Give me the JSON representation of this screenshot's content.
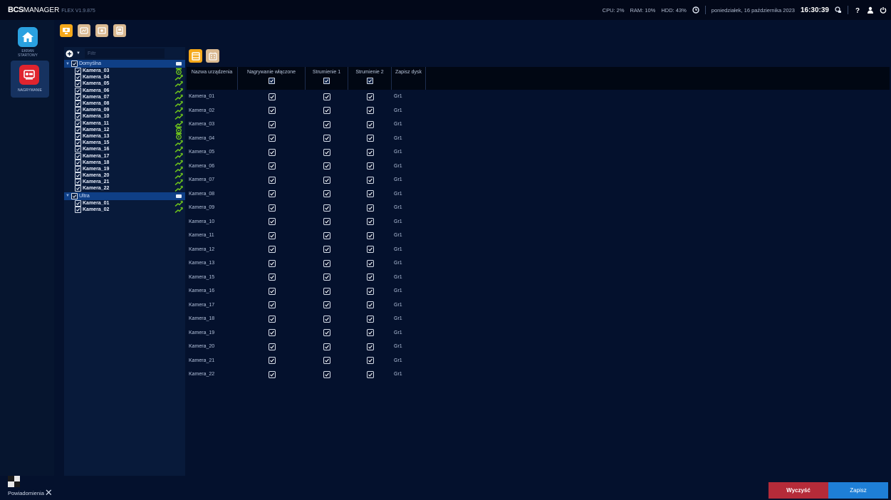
{
  "app": {
    "brand_bcs": "BCS",
    "brand_manager": "MANAGER",
    "version": "FLEX V1.9.875"
  },
  "status": {
    "cpu": "CPU:  2%",
    "ram": "RAM:  10%",
    "hdd": "HDD:  43%",
    "date": "poniedziałek, 16 października 2023",
    "time": "16:30:39"
  },
  "nav": {
    "home_label_1": "EKRAN",
    "home_label_2": "STARTOWY",
    "rec_label": "NAGRYWANIE"
  },
  "tree": {
    "filter_placeholder": "Filtr",
    "groups": [
      {
        "name": "Domyślna",
        "cameras": [
          {
            "name": "Kamera_03",
            "status": "record"
          },
          {
            "name": "Kamera_04",
            "status": "signal"
          },
          {
            "name": "Kamera_05",
            "status": "signal"
          },
          {
            "name": "Kamera_06",
            "status": "signal"
          },
          {
            "name": "Kamera_07",
            "status": "signal"
          },
          {
            "name": "Kamera_08",
            "status": "signal"
          },
          {
            "name": "Kamera_09",
            "status": "signal"
          },
          {
            "name": "Kamera_10",
            "status": "signal"
          },
          {
            "name": "Kamera_11",
            "status": "signal"
          },
          {
            "name": "Kamera_12",
            "status": "record"
          },
          {
            "name": "Kamera_13",
            "status": "record"
          },
          {
            "name": "Kamera_15",
            "status": "signal"
          },
          {
            "name": "Kamera_16",
            "status": "signal"
          },
          {
            "name": "Kamera_17",
            "status": "signal"
          },
          {
            "name": "Kamera_18",
            "status": "signal"
          },
          {
            "name": "Kamera_19",
            "status": "signal"
          },
          {
            "name": "Kamera_20",
            "status": "signal"
          },
          {
            "name": "Kamera_21",
            "status": "signal"
          },
          {
            "name": "Kamera_22",
            "status": "signal"
          }
        ]
      },
      {
        "name": "Ultra",
        "cameras": [
          {
            "name": "Kamera_01",
            "status": "signal"
          },
          {
            "name": "Kamera_02",
            "status": "signal"
          }
        ]
      }
    ]
  },
  "table": {
    "headers": {
      "name": "Nazwa urządzenia",
      "recording": "Nagrywanie włączone",
      "stream1": "Strumienie 1",
      "stream2": "Strumienie 2",
      "disk": "Zapisz dysk"
    },
    "rows": [
      {
        "name": "Kamera_01",
        "recording": true,
        "stream1": true,
        "stream2": true,
        "disk": "Gr1"
      },
      {
        "name": "Kamera_02",
        "recording": true,
        "stream1": true,
        "stream2": true,
        "disk": "Gr1"
      },
      {
        "name": "Kamera_03",
        "recording": true,
        "stream1": true,
        "stream2": true,
        "disk": "Gr1"
      },
      {
        "name": "Kamera_04",
        "recording": true,
        "stream1": true,
        "stream2": true,
        "disk": "Gr1"
      },
      {
        "name": "Kamera_05",
        "recording": true,
        "stream1": true,
        "stream2": true,
        "disk": "Gr1"
      },
      {
        "name": "Kamera_06",
        "recording": true,
        "stream1": true,
        "stream2": true,
        "disk": "Gr1"
      },
      {
        "name": "Kamera_07",
        "recording": true,
        "stream1": true,
        "stream2": true,
        "disk": "Gr1"
      },
      {
        "name": "Kamera_08",
        "recording": true,
        "stream1": true,
        "stream2": true,
        "disk": "Gr1"
      },
      {
        "name": "Kamera_09",
        "recording": true,
        "stream1": true,
        "stream2": true,
        "disk": "Gr1"
      },
      {
        "name": "Kamera_10",
        "recording": true,
        "stream1": true,
        "stream2": true,
        "disk": "Gr1"
      },
      {
        "name": "Kamera_11",
        "recording": true,
        "stream1": true,
        "stream2": true,
        "disk": "Gr1"
      },
      {
        "name": "Kamera_12",
        "recording": true,
        "stream1": true,
        "stream2": true,
        "disk": "Gr1"
      },
      {
        "name": "Kamera_13",
        "recording": true,
        "stream1": true,
        "stream2": true,
        "disk": "Gr1"
      },
      {
        "name": "Kamera_15",
        "recording": true,
        "stream1": true,
        "stream2": true,
        "disk": "Gr1"
      },
      {
        "name": "Kamera_16",
        "recording": true,
        "stream1": true,
        "stream2": true,
        "disk": "Gr1"
      },
      {
        "name": "Kamera_17",
        "recording": true,
        "stream1": true,
        "stream2": true,
        "disk": "Gr1"
      },
      {
        "name": "Kamera_18",
        "recording": true,
        "stream1": true,
        "stream2": true,
        "disk": "Gr1"
      },
      {
        "name": "Kamera_19",
        "recording": true,
        "stream1": true,
        "stream2": true,
        "disk": "Gr1"
      },
      {
        "name": "Kamera_20",
        "recording": true,
        "stream1": true,
        "stream2": true,
        "disk": "Gr1"
      },
      {
        "name": "Kamera_21",
        "recording": true,
        "stream1": true,
        "stream2": true,
        "disk": "Gr1"
      },
      {
        "name": "Kamera_22",
        "recording": true,
        "stream1": true,
        "stream2": true,
        "disk": "Gr1"
      }
    ]
  },
  "footer": {
    "notifications": "Powiadomienia",
    "clear": "Wyczyść",
    "save": "Zapisz"
  },
  "colors": {
    "accent": "#1e7fd7",
    "danger": "#b52b39",
    "signal_ok": "#6dc21c",
    "tab_active": "#f5a81a"
  }
}
